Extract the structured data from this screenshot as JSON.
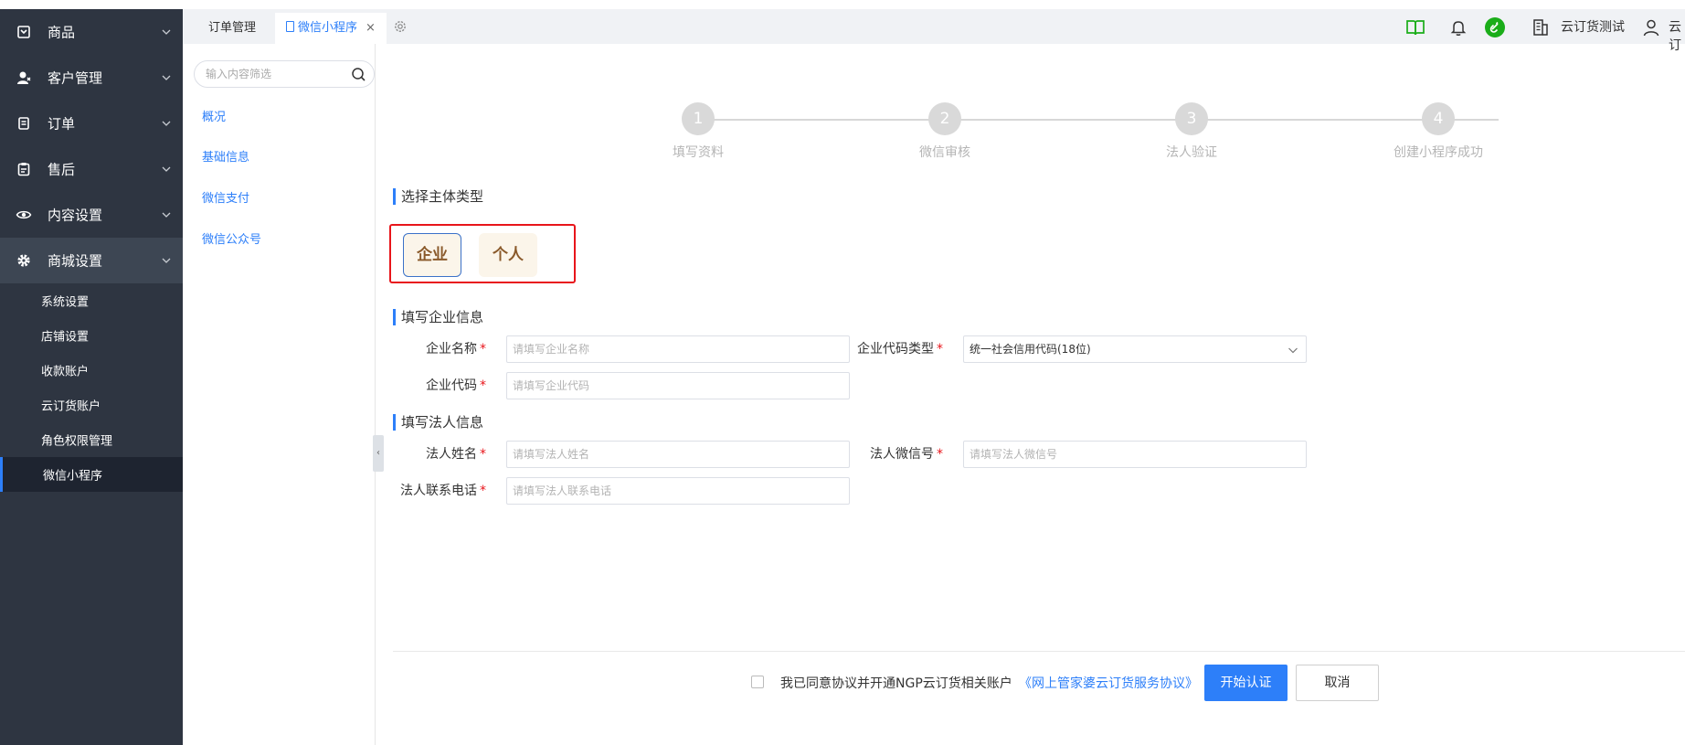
{
  "sidebar": {
    "items": [
      {
        "label": "商品",
        "icon": "box-icon"
      },
      {
        "label": "客户管理",
        "icon": "user-icon"
      },
      {
        "label": "订单",
        "icon": "order-icon"
      },
      {
        "label": "售后",
        "icon": "clipboard-icon"
      },
      {
        "label": "内容设置",
        "icon": "eye-icon"
      },
      {
        "label": "商城设置",
        "icon": "gear-icon"
      }
    ],
    "sub_items": [
      "系统设置",
      "店铺设置",
      "收款账户",
      "云订货账户",
      "角色权限管理",
      "微信小程序"
    ],
    "active_sub": "微信小程序"
  },
  "tabs": [
    {
      "label": "订单管理"
    },
    {
      "label": "微信小程序",
      "close": "×"
    }
  ],
  "topbar": {
    "company": "云订货测试",
    "user_partial": "云订"
  },
  "submenu": {
    "search_placeholder": "输入内容筛选",
    "links": [
      "概况",
      "基础信息",
      "微信支付",
      "微信公众号"
    ]
  },
  "steps": [
    {
      "num": "1",
      "label": "填写资料"
    },
    {
      "num": "2",
      "label": "微信审核"
    },
    {
      "num": "3",
      "label": "法人验证"
    },
    {
      "num": "4",
      "label": "创建小程序成功"
    }
  ],
  "form": {
    "section_type": "选择主体类型",
    "type_options": [
      "企业",
      "个人"
    ],
    "selected_type": "企业",
    "section_company": "填写企业信息",
    "company_name_label": "企业名称",
    "company_name_placeholder": "请填写企业名称",
    "code_type_label": "企业代码类型",
    "code_type_value": "统一社会信用代码(18位)",
    "company_code_label": "企业代码",
    "company_code_placeholder": "请填写企业代码",
    "section_legal": "填写法人信息",
    "legal_name_label": "法人姓名",
    "legal_name_placeholder": "请填写法人姓名",
    "legal_wechat_label": "法人微信号",
    "legal_wechat_placeholder": "请填写法人微信号",
    "legal_phone_label": "法人联系电话",
    "legal_phone_placeholder": "请填写法人联系电话",
    "required_mark": "*"
  },
  "footer": {
    "agree_text": "我已同意协议并开通NGP云订货相关账户",
    "agree_link": "《网上管家婆云订货服务协议》",
    "start_button": "开始认证",
    "cancel_button": "取消"
  },
  "colors": {
    "sidebar_bg": "#2e3541",
    "accent": "#2d7ff9",
    "highlight_red": "#e8151b",
    "wechat_green": "#1aad19"
  }
}
